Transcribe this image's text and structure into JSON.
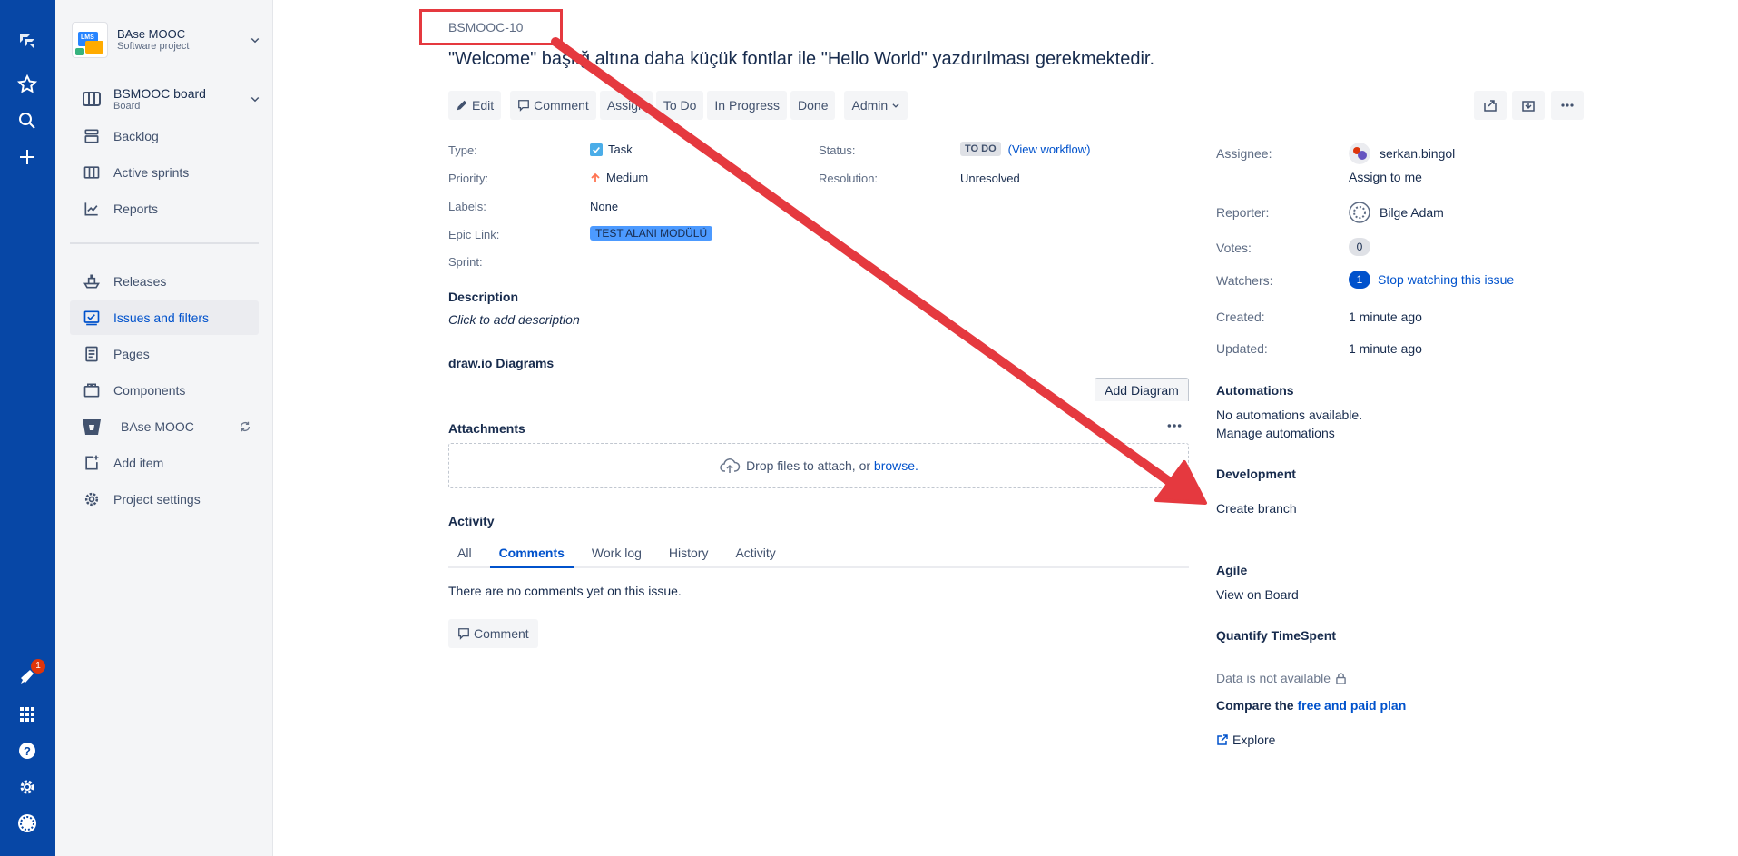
{
  "global_nav": {
    "notification_count": "1"
  },
  "sidebar": {
    "project_name": "BAse MOOC",
    "project_type": "Software project",
    "board_name": "BSMOOC board",
    "board_sub": "Board",
    "items": [
      {
        "label": "Backlog"
      },
      {
        "label": "Active sprints"
      },
      {
        "label": "Reports"
      },
      {
        "label": "Releases"
      },
      {
        "label": "Issues and filters"
      },
      {
        "label": "Pages"
      },
      {
        "label": "Components"
      },
      {
        "label": "BAse MOOC"
      },
      {
        "label": "Add item"
      },
      {
        "label": "Project settings"
      }
    ]
  },
  "issue": {
    "key": "BSMOOC-10",
    "title": "\"Welcome\" başlığı altına daha küçük fontlar ile \"Hello World\" yazdırılması gerekmektedir.",
    "title_visible": "\"Welcome\" başlığ altına daha küçük fontlar ile \"Hello World\" yazdırılması gerekmektedir."
  },
  "toolbar": {
    "edit": "Edit",
    "comment": "Comment",
    "assign": "Assign",
    "todo": "To Do",
    "in_progress": "In Progress",
    "done": "Done",
    "admin": "Admin"
  },
  "details": {
    "type_label": "Type:",
    "type_value": "Task",
    "priority_label": "Priority:",
    "priority_value": "Medium",
    "labels_label": "Labels:",
    "labels_value": "None",
    "epic_label": "Epic Link:",
    "epic_value": "TEST ALANI MODÜLÜ",
    "sprint_label": "Sprint:",
    "status_label": "Status:",
    "status_value": "TO DO",
    "view_workflow": "(View workflow)",
    "resolution_label": "Resolution:",
    "resolution_value": "Unresolved"
  },
  "description": {
    "title": "Description",
    "placeholder": "Click to add description"
  },
  "drawio": {
    "title": "draw.io Diagrams",
    "add_button": "Add Diagram"
  },
  "attachments": {
    "title": "Attachments",
    "drop_text": "Drop files to attach, or",
    "browse": "browse."
  },
  "activity": {
    "title": "Activity",
    "tabs": [
      "All",
      "Comments",
      "Work log",
      "History",
      "Activity"
    ],
    "active_tab": "Comments",
    "empty": "There are no comments yet on this issue.",
    "comment_button": "Comment"
  },
  "people": {
    "assignee_label": "Assignee:",
    "assignee": "serkan.bingol",
    "assign_to_me": "Assign to me",
    "reporter_label": "Reporter:",
    "reporter": "Bilge Adam",
    "votes_label": "Votes:",
    "votes": "0",
    "watchers_label": "Watchers:",
    "watchers": "1",
    "stop_watching": "Stop watching this issue",
    "created_label": "Created:",
    "created": "1 minute ago",
    "updated_label": "Updated:",
    "updated": "1 minute ago"
  },
  "automations": {
    "title": "Automations",
    "none": "No automations available.",
    "manage": "Manage automations"
  },
  "development": {
    "title": "Development",
    "create_branch": "Create branch"
  },
  "agile": {
    "title": "Agile",
    "view_on_board": "View on Board"
  },
  "quantify": {
    "title": "Quantify TimeSpent",
    "unavailable": "Data is not available",
    "compare_prefix": "Compare the",
    "compare_link": "free and paid plan",
    "explore": "Explore"
  },
  "colors": {
    "nav_bg": "#0747a6",
    "link": "#0052cc",
    "annotation": "#e5393f"
  }
}
